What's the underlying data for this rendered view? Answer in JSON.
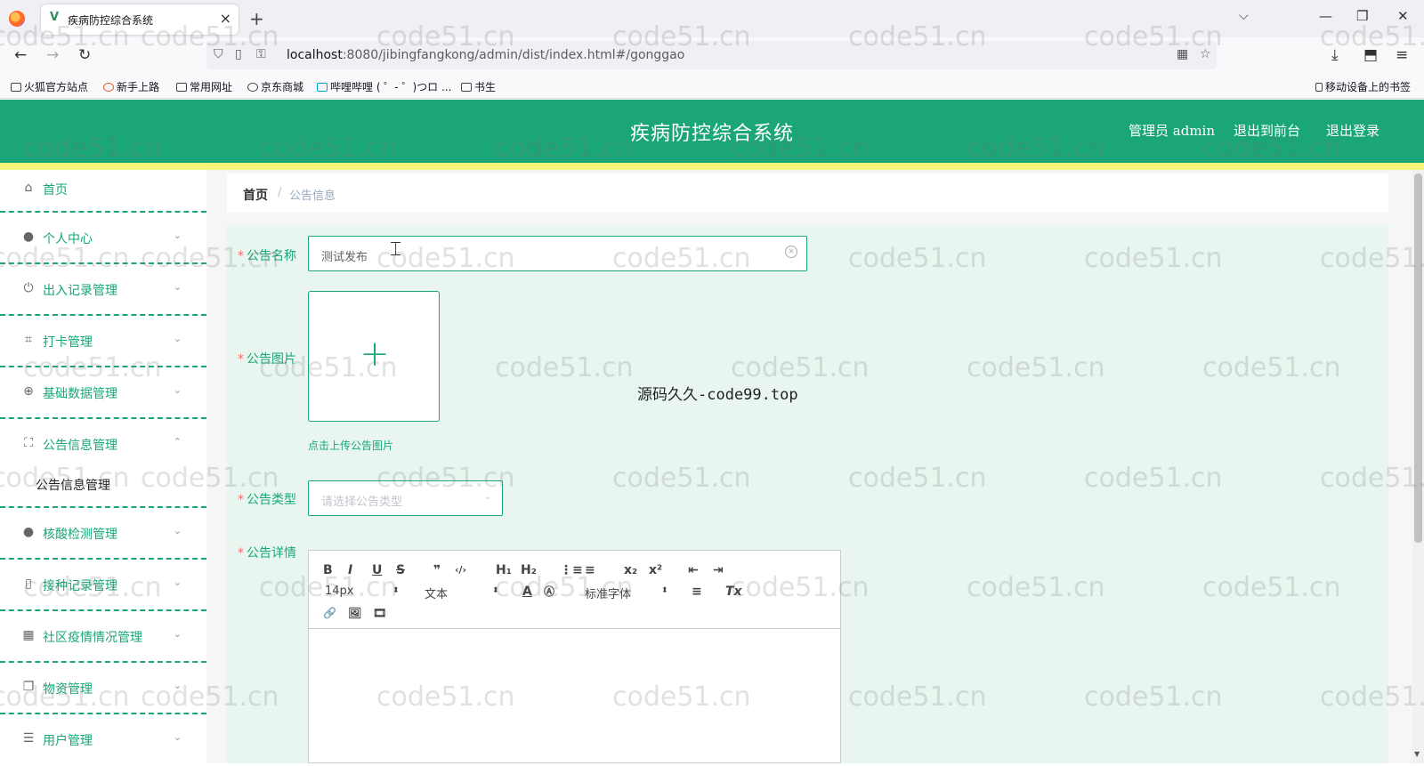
{
  "browser": {
    "tab_title": "疾病防控综合系统",
    "tab_close": "×",
    "new_tab": "+",
    "tabs_list": "⌵",
    "url_host": "localhost",
    "url_rest": ":8080/jibingfangkong/admin/dist/index.html#/gonggao",
    "window_minimize": "—",
    "window_restore": "❐",
    "window_close": "✕",
    "nav": {
      "back": "←",
      "forward": "→",
      "reload": "↻",
      "star": "☆",
      "download": "⤓",
      "extensions": "⬒",
      "menu": "≡"
    },
    "bookmarks": [
      "火狐官方站点",
      "新手上路",
      "常用网址",
      "京东商城",
      "哔哩哔哩 ( ゜- ゜)つロ ...",
      "书生"
    ],
    "mobile_bookmarks": "移动设备上的书签"
  },
  "header": {
    "title": "疾病防控综合系统",
    "user_label": "管理员 admin",
    "to_front": "退出到前台",
    "logout": "退出登录"
  },
  "sidebar": {
    "items": [
      {
        "label": "首页",
        "icon": "home-icon",
        "glyph": "⌂",
        "caret": ""
      },
      {
        "label": "个人中心",
        "icon": "user-icon",
        "glyph": "●",
        "caret": "⌄"
      },
      {
        "label": "出入记录管理",
        "icon": "power-icon",
        "glyph": "⏻",
        "caret": "⌄"
      },
      {
        "label": "打卡管理",
        "icon": "crop-icon",
        "glyph": "⌗",
        "caret": "⌄"
      },
      {
        "label": "基础数据管理",
        "icon": "globe-icon",
        "glyph": "⊕",
        "caret": "⌄"
      },
      {
        "label": "公告信息管理",
        "icon": "fullscreen-icon",
        "glyph": "⛶",
        "caret": "⌃"
      },
      {
        "label": "核酸检测管理",
        "icon": "user-icon",
        "glyph": "●",
        "caret": "⌄"
      },
      {
        "label": "接种记录管理",
        "icon": "mobile-icon",
        "glyph": "▯",
        "caret": "⌄"
      },
      {
        "label": "社区疫情情况管理",
        "icon": "grid-icon",
        "glyph": "▦",
        "caret": "⌄"
      },
      {
        "label": "物资管理",
        "icon": "copy-icon",
        "glyph": "❐",
        "caret": "⌄"
      },
      {
        "label": "用户管理",
        "icon": "list-icon",
        "glyph": "☰",
        "caret": "⌄"
      }
    ],
    "sub_item": "公告信息管理"
  },
  "breadcrumb": {
    "home": "首页",
    "sep": "/",
    "current": "公告信息"
  },
  "form": {
    "name_label": "公告名称",
    "name_value": "测试发布",
    "image_label": "公告图片",
    "upload_plus": "+",
    "upload_tip": "点击上传公告图片",
    "type_label": "公告类型",
    "type_placeholder": "请选择公告类型",
    "detail_label": "公告详情",
    "required_mark": "*"
  },
  "editor": {
    "size": "14px",
    "header": "文本",
    "font": "标准字体",
    "tools_row1": [
      "B",
      "I",
      "U",
      "S",
      "❞",
      "‹/›",
      "H₁",
      "H₂",
      "⋮≡",
      "≡",
      "x₂",
      "x²",
      "⇤",
      "⇥"
    ],
    "tools_row2": [
      "A",
      "Ⓐ",
      "≡",
      "Tx"
    ],
    "tools_row3": [
      "🔗",
      "🖼",
      "🎞"
    ]
  },
  "watermark": {
    "center": "源码久久-code99.top",
    "repeat": "code51.cn"
  },
  "colors": {
    "primary": "#1aa676",
    "strip": "#f5f57a",
    "panel": "#e8f6ef",
    "required": "#f56c6c"
  }
}
